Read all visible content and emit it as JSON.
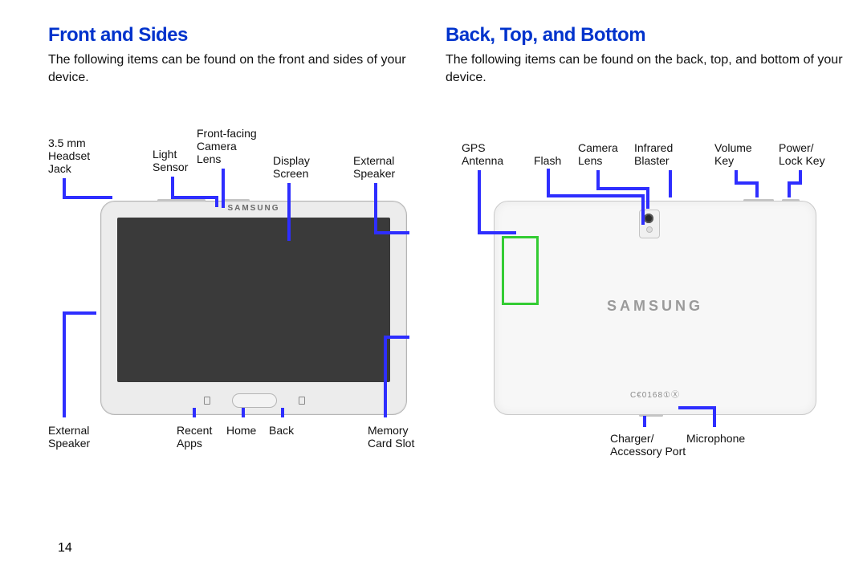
{
  "page_number": "14",
  "sections": {
    "front": {
      "heading": "Front and Sides",
      "intro": "The following items can be found on the front and sides of your device.",
      "labels": {
        "headset_jack": "3.5 mm\nHeadset\nJack",
        "light_sensor": "Light\nSensor",
        "front_camera": "Front-facing\nCamera\nLens",
        "display_screen": "Display\nScreen",
        "external_speaker_top": "External\nSpeaker",
        "external_speaker_bottom": "External\nSpeaker",
        "recent_apps": "Recent\nApps",
        "home": "Home",
        "back": "Back",
        "memory_slot": "Memory\nCard Slot"
      },
      "brand_text": "SAMSUNG"
    },
    "back": {
      "heading": "Back, Top, and Bottom",
      "intro": "The following items can be found on the back, top, and bottom of your device.",
      "labels": {
        "gps": "GPS\nAntenna",
        "flash": "Flash",
        "camera_lens": "Camera\nLens",
        "ir_blaster": "Infrared\nBlaster",
        "volume": "Volume\nKey",
        "power": "Power/\nLock Key",
        "charger": "Charger/\nAccessory Port",
        "microphone": "Microphone"
      },
      "brand_text": "SAMSUNG",
      "ce_text": "C€0168①Ⓧ"
    }
  }
}
